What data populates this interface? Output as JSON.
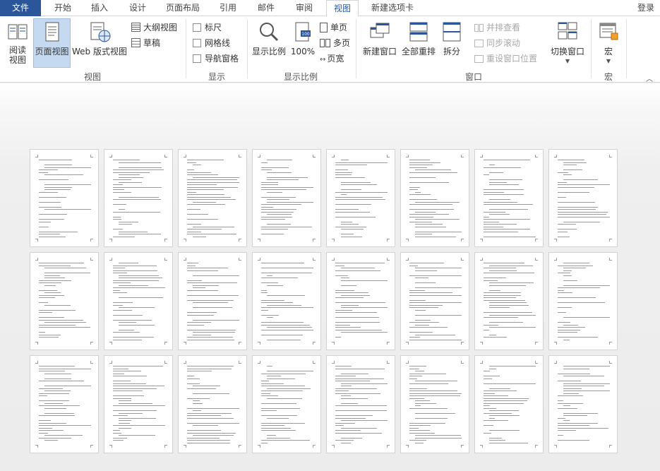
{
  "tabs": {
    "file": "文件",
    "home": "开始",
    "insert": "插入",
    "design": "设计",
    "layout": "页面布局",
    "references": "引用",
    "mailings": "邮件",
    "review": "审阅",
    "view": "视图",
    "new_tab": "新建选项卡",
    "login": "登录"
  },
  "ribbon": {
    "views": {
      "group": "视图",
      "read_mode_line1": "阅读",
      "read_mode_line2": "视图",
      "print_layout": "页面视图",
      "web_layout": "Web 版式视图",
      "outline": "大纲视图",
      "draft": "草稿"
    },
    "show": {
      "group": "显示",
      "ruler": "标尺",
      "gridlines": "网格线",
      "nav_pane": "导航窗格"
    },
    "zoom": {
      "group": "显示比例",
      "zoom": "显示比例",
      "percent100": "100%",
      "one_page": "单页",
      "multi_page": "多页",
      "page_width": "页宽"
    },
    "window": {
      "group": "窗口",
      "new_window": "新建窗口",
      "arrange_all": "全部重排",
      "split": "拆分",
      "side_by_side": "并排查看",
      "sync_scroll": "同步滚动",
      "reset_position": "重设窗口位置",
      "switch_windows": "切换窗口"
    },
    "macros": {
      "group": "宏",
      "macros": "宏"
    }
  },
  "colors": {
    "file_tab": "#2b579a",
    "selected_button": "#c5daf0"
  }
}
